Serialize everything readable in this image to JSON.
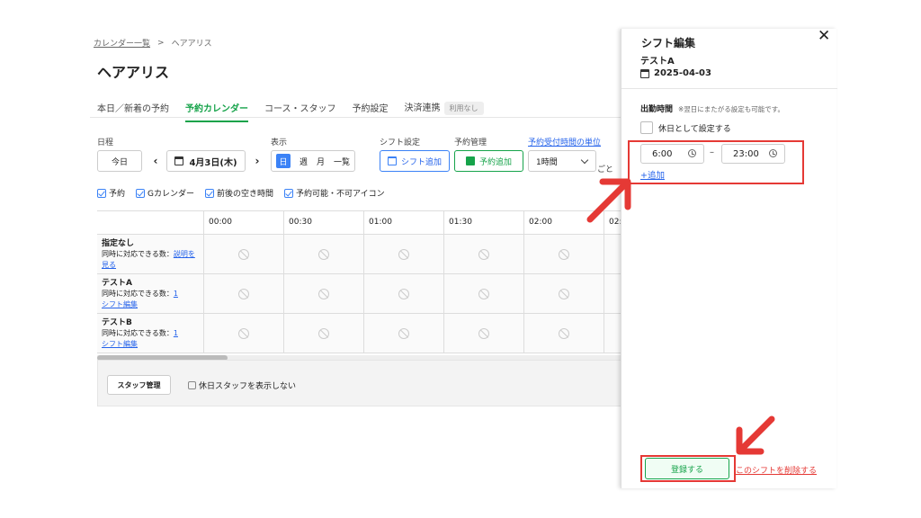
{
  "breadcrumb": {
    "parent": "カレンダー一覧",
    "separator": ">",
    "current": "ヘアアリス"
  },
  "page_title": "ヘアアリス",
  "tabs": [
    {
      "label": "本日／新着の予約"
    },
    {
      "label": "予約カレンダー"
    },
    {
      "label": "コース・スタッフ"
    },
    {
      "label": "予約設定"
    },
    {
      "label": "決済連携"
    }
  ],
  "tab_badge": "利用なし",
  "controls": {
    "date_label": "日程",
    "today": "今日",
    "prev": "‹",
    "next": "›",
    "date_value": "4月3日(木)",
    "view_label": "表示",
    "view_day": "日",
    "view_week": "週",
    "view_month": "月",
    "view_list": "一覧",
    "shift_label": "シフト設定",
    "shift_add": "シフト追加",
    "reserve_label": "予約管理",
    "reserve_add": "予約追加",
    "unit_link": "予約受付時間の単位",
    "unit_value": "1時間",
    "unit_suffix": "ごと"
  },
  "filters": [
    "予約",
    "Gカレンダー",
    "前後の空き時間",
    "予約可能・不可アイコン"
  ],
  "grid": {
    "times": [
      "00:00",
      "00:30",
      "01:00",
      "01:30",
      "02:00",
      "02:"
    ],
    "rows": [
      {
        "name": "指定なし",
        "sub": "同時に対応できる数：",
        "link": "説明を見る",
        "edit": ""
      },
      {
        "name": "テストA",
        "sub": "同時に対応できる数：",
        "link": "1",
        "edit": "シフト編集"
      },
      {
        "name": "テストB",
        "sub": "同時に対応できる数：",
        "link": "1",
        "edit": "シフト編集"
      }
    ]
  },
  "footer": {
    "staff_button": "スタッフ管理",
    "hide_holiday": "休日スタッフを表示しない"
  },
  "panel": {
    "title": "シフト編集",
    "staff": "テストA",
    "date": "2025-04-03",
    "close": "✕",
    "work_label": "出勤時間",
    "work_note": "※翌日にまたがる設定も可能です。",
    "holiday": "休日として設定する",
    "start": "6:00",
    "dash": "–",
    "end": "23:00",
    "add": "+追加",
    "register": "登録する",
    "delete": "このシフトを削除する"
  },
  "colors": {
    "accent_green": "#16a34a",
    "link_blue": "#2563eb",
    "highlight_red": "#e53935"
  }
}
